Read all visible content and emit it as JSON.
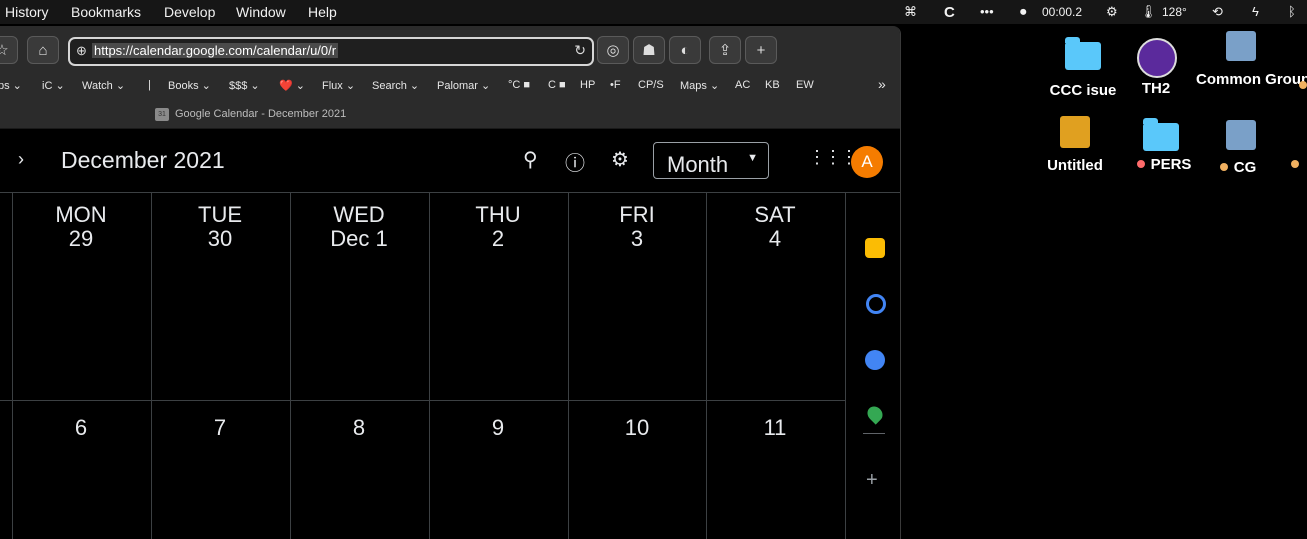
{
  "menubar": {
    "items": [
      "History",
      "Bookmarks",
      "Develop",
      "Window",
      "Help"
    ],
    "status": {
      "timer": "00:00.2",
      "temp": "128°"
    }
  },
  "browser": {
    "url": "https://calendar.google.com/calendar/u/0/r",
    "bookmarks": [
      "ps ⌄",
      "iC ⌄",
      "Watch ⌄",
      "|",
      "Books ⌄",
      "$$$ ⌄",
      "❤️ ⌄",
      "Flux ⌄",
      "Search ⌄",
      "Palomar ⌄",
      "°C ■",
      "C ■",
      "HP",
      "•F",
      "CP/S",
      "Maps ⌄",
      "AC",
      "KB",
      "EW"
    ],
    "tab_title": "Google Calendar - December 2021"
  },
  "calendar": {
    "month_title": "December 2021",
    "view_label": "Month",
    "avatar_letter": "A",
    "days": [
      {
        "dow": "MON",
        "date": "29"
      },
      {
        "dow": "TUE",
        "date": "30"
      },
      {
        "dow": "WED",
        "date": "Dec 1"
      },
      {
        "dow": "THU",
        "date": "2"
      },
      {
        "dow": "FRI",
        "date": "3"
      },
      {
        "dow": "SAT",
        "date": "4"
      }
    ],
    "week2": [
      "6",
      "7",
      "8",
      "9",
      "10",
      "11"
    ]
  },
  "desktop": {
    "icons": [
      {
        "label": "CCC isue"
      },
      {
        "label": "TH2"
      },
      {
        "label": "Common Ground"
      },
      {
        "label": "Untitled"
      },
      {
        "label": "PERS"
      },
      {
        "label": "CG"
      }
    ]
  },
  "colors": {
    "accent_orange": "#f57c00",
    "folder_blue": "#5ac8fa",
    "grid_line": "#3c4043"
  }
}
